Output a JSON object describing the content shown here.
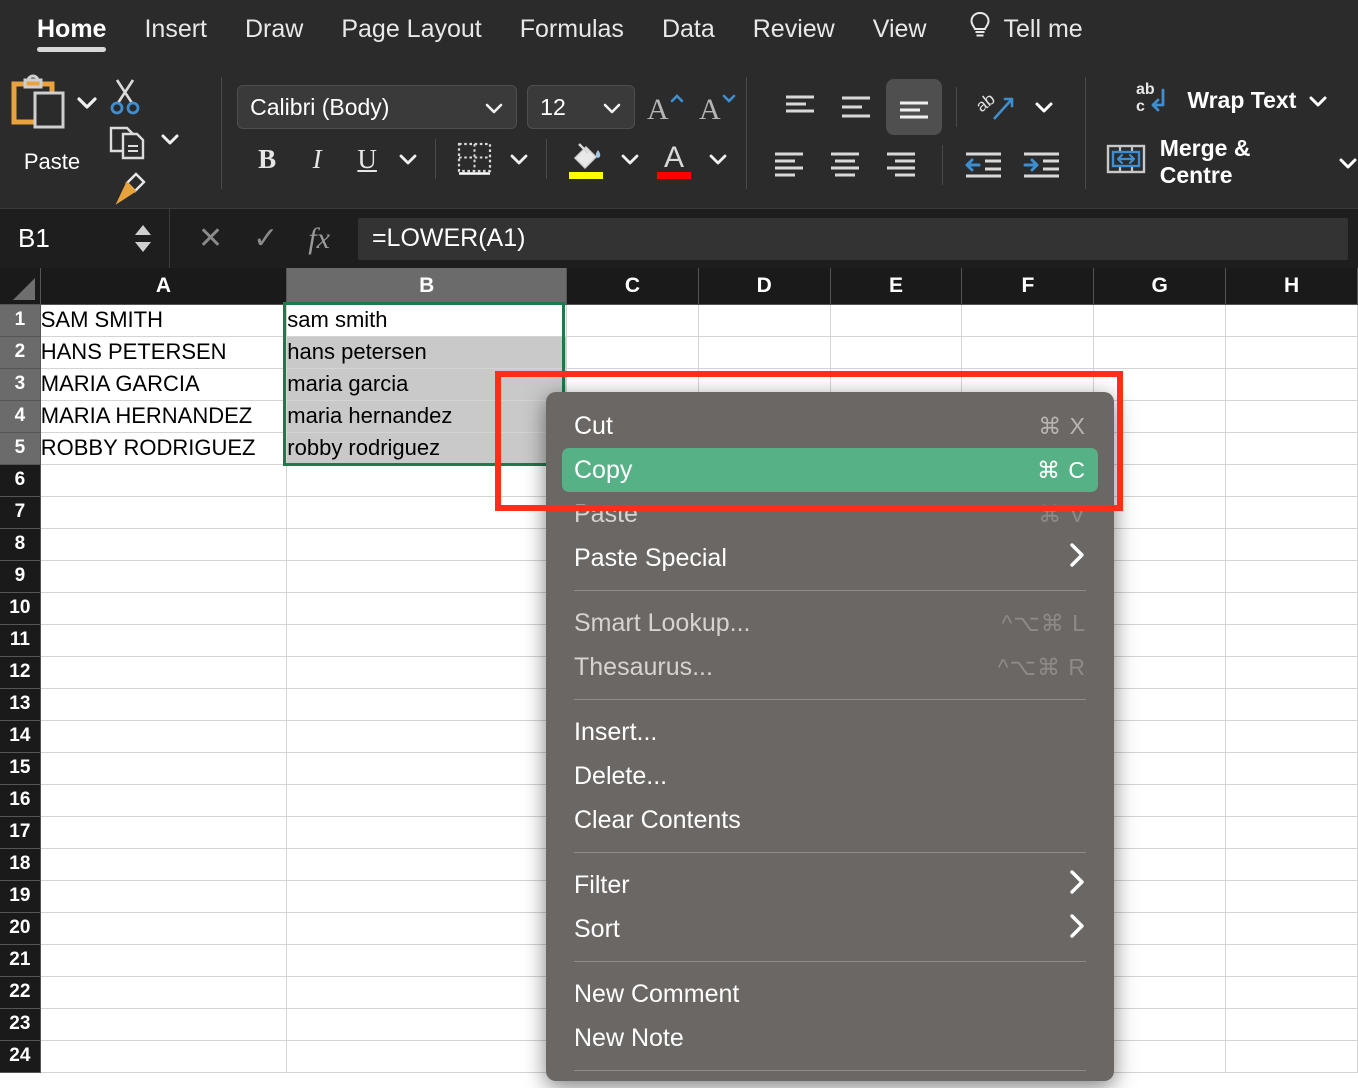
{
  "ribbon": {
    "tabs": [
      {
        "label": "Home",
        "active": true
      },
      {
        "label": "Insert",
        "active": false
      },
      {
        "label": "Draw",
        "active": false
      },
      {
        "label": "Page Layout",
        "active": false
      },
      {
        "label": "Formulas",
        "active": false
      },
      {
        "label": "Data",
        "active": false
      },
      {
        "label": "Review",
        "active": false
      },
      {
        "label": "View",
        "active": false
      }
    ],
    "tell_me": "Tell me",
    "clipboard": {
      "paste_label": "Paste",
      "cut_tooltip": "Cut",
      "copy_tooltip": "Copy",
      "format_painter_tooltip": "Format Painter"
    },
    "font": {
      "family": "Calibri (Body)",
      "size": "12",
      "bold": "B",
      "italic": "I",
      "underline": "U",
      "grow_font": "A",
      "shrink_font": "A",
      "fill_color_hex": "#ffff00",
      "font_color_hex": "#ff0000"
    },
    "alignment": {
      "top_align": "Top Align",
      "middle_align": "Middle Align",
      "bottom_align": "Bottom Align",
      "orientation": "Orientation",
      "align_left": "Align Left",
      "center": "Center",
      "align_right": "Align Right",
      "decrease_indent": "Decrease Indent",
      "increase_indent": "Increase Indent"
    },
    "wrap": {
      "wrap_text": "Wrap Text",
      "merge_centre": "Merge & Centre"
    }
  },
  "formula_bar": {
    "name_box": "B1",
    "cancel": "✕",
    "enter": "✓",
    "fx": "fx",
    "formula": "=LOWER(A1)"
  },
  "sheet": {
    "columns": [
      "A",
      "B",
      "C",
      "D",
      "E",
      "F",
      "G",
      "H"
    ],
    "selected_columns": [
      "B"
    ],
    "rows": [
      1,
      2,
      3,
      4,
      5,
      6,
      7,
      8,
      9,
      10,
      11,
      12,
      13,
      14,
      15,
      16,
      17,
      18,
      19,
      20,
      21,
      22,
      23,
      24
    ],
    "selected_rows": [
      1,
      2,
      3,
      4,
      5
    ],
    "data": [
      {
        "A": "SAM SMITH",
        "B": "sam smith"
      },
      {
        "A": "HANS PETERSEN",
        "B": "hans petersen"
      },
      {
        "A": "MARIA GARCIA",
        "B": "maria garcia"
      },
      {
        "A": "MARIA HERNANDEZ",
        "B": "maria hernandez"
      },
      {
        "A": "ROBBY RODRIGUEZ",
        "B": "robby rodriguez"
      }
    ],
    "active_cell": "B1",
    "selection_range": "B1:B5",
    "selection_color_hex": "#1c7a4d",
    "shaded_fill_hex": "#c9c9c9"
  },
  "annotation": {
    "color_hex": "#ff2d1a",
    "target": "Copy"
  },
  "context_menu": {
    "items": [
      {
        "label": "Cut",
        "shortcut": "⌘ X",
        "state": "normal",
        "submenu": false
      },
      {
        "label": "Copy",
        "shortcut": "⌘ C",
        "state": "highlight",
        "submenu": false
      },
      {
        "label": "Paste",
        "shortcut": "⌘ V",
        "state": "disabled",
        "submenu": false
      },
      {
        "label": "Paste Special",
        "shortcut": "",
        "state": "normal",
        "submenu": true
      },
      {
        "separator": true
      },
      {
        "label": "Smart Lookup...",
        "shortcut": "^⌥⌘ L",
        "state": "disabled",
        "submenu": false
      },
      {
        "label": "Thesaurus...",
        "shortcut": "^⌥⌘ R",
        "state": "disabled",
        "submenu": false
      },
      {
        "separator": true
      },
      {
        "label": "Insert...",
        "shortcut": "",
        "state": "normal",
        "submenu": false
      },
      {
        "label": "Delete...",
        "shortcut": "",
        "state": "normal",
        "submenu": false
      },
      {
        "label": "Clear Contents",
        "shortcut": "",
        "state": "normal",
        "submenu": false
      },
      {
        "separator": true
      },
      {
        "label": "Filter",
        "shortcut": "",
        "state": "normal",
        "submenu": true
      },
      {
        "label": "Sort",
        "shortcut": "",
        "state": "normal",
        "submenu": true
      },
      {
        "separator": true
      },
      {
        "label": "New Comment",
        "shortcut": "",
        "state": "normal",
        "submenu": false
      },
      {
        "label": "New Note",
        "shortcut": "",
        "state": "normal",
        "submenu": false
      },
      {
        "separator": true
      }
    ]
  }
}
